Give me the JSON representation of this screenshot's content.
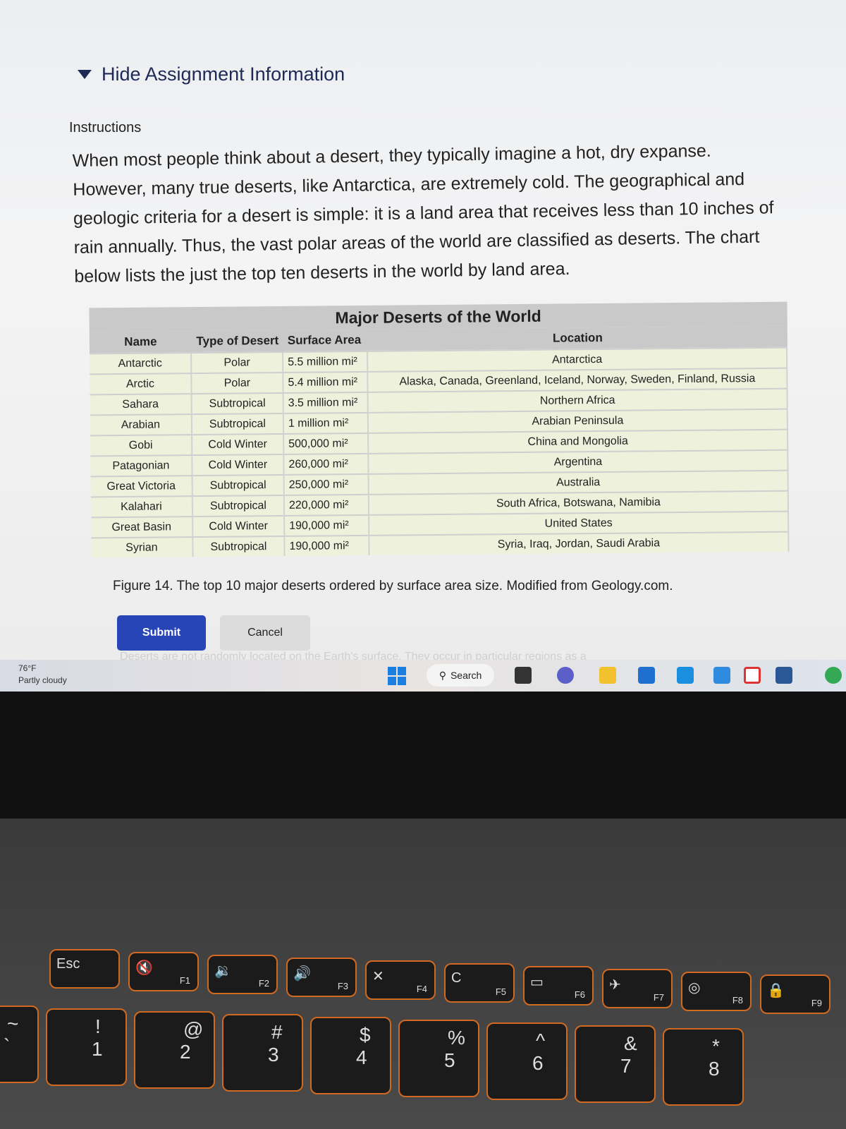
{
  "assignment": {
    "toggle_label": "Hide Assignment Information",
    "instructions_heading": "Instructions",
    "instructions_text": "When most people think about a desert, they typically imagine a hot, dry expanse. However, many true deserts, like Antarctica, are extremely cold. The geographical and geologic criteria for a desert is simple: it is a land area that receives less than 10 inches of rain annually. Thus, the vast polar areas of the world are classified as deserts. The chart below lists the just the top ten deserts in the world by land area."
  },
  "table": {
    "title": "Major Deserts of the World",
    "headers": [
      "Name",
      "Type of Desert",
      "Surface Area",
      "Location"
    ],
    "rows": [
      [
        "Antarctic",
        "Polar",
        "5.5 million mi²",
        "Antarctica"
      ],
      [
        "Arctic",
        "Polar",
        "5.4 million mi²",
        "Alaska, Canada, Greenland, Iceland, Norway, Sweden, Finland, Russia"
      ],
      [
        "Sahara",
        "Subtropical",
        "3.5 million mi²",
        "Northern Africa"
      ],
      [
        "Arabian",
        "Subtropical",
        "1 million mi²",
        "Arabian Peninsula"
      ],
      [
        "Gobi",
        "Cold Winter",
        "500,000 mi²",
        "China and Mongolia"
      ],
      [
        "Patagonian",
        "Cold Winter",
        "260,000 mi²",
        "Argentina"
      ],
      [
        "Great Victoria",
        "Subtropical",
        "250,000 mi²",
        "Australia"
      ],
      [
        "Kalahari",
        "Subtropical",
        "220,000 mi²",
        "South Africa, Botswana, Namibia"
      ],
      [
        "Great Basin",
        "Cold Winter",
        "190,000 mi²",
        "United States"
      ],
      [
        "Syrian",
        "Subtropical",
        "190,000 mi²",
        "Syria, Iraq, Jordan, Saudi Arabia"
      ]
    ]
  },
  "caption": "Figure 14. The top 10 major deserts ordered by surface area size. Modified from Geology.com.",
  "buttons": {
    "submit": "Submit",
    "cancel": "Cancel"
  },
  "faded_text": "Deserts are not randomly located on the Earth's surface. They occur in particular regions as a",
  "taskbar": {
    "temperature": "76°F",
    "weather": "Partly cloudy",
    "search_label": "Search"
  },
  "keyboard": {
    "keys": [
      {
        "main": "Esc",
        "sub": ""
      },
      {
        "main": "🔇",
        "sub": "F1"
      },
      {
        "main": "🔉",
        "sub": "F2"
      },
      {
        "main": "🔊",
        "sub": "F3"
      },
      {
        "main": "✕",
        "sub": "F4"
      },
      {
        "main": "C",
        "sub": "F5"
      },
      {
        "main": "▭",
        "sub": "F6"
      },
      {
        "main": "✈",
        "sub": "F7"
      },
      {
        "main": "◎",
        "sub": "F8"
      },
      {
        "main": "🔒",
        "sub": "F9"
      }
    ],
    "numbers": [
      {
        "top": "~",
        "bot": "`"
      },
      {
        "top": "!",
        "bot": "1"
      },
      {
        "top": "@",
        "bot": "2"
      },
      {
        "top": "#",
        "bot": "3"
      },
      {
        "top": "$",
        "bot": "4"
      },
      {
        "top": "%",
        "bot": "5"
      },
      {
        "top": "^",
        "bot": "6"
      },
      {
        "top": "&",
        "bot": "7"
      },
      {
        "top": "*",
        "bot": "8"
      }
    ]
  }
}
